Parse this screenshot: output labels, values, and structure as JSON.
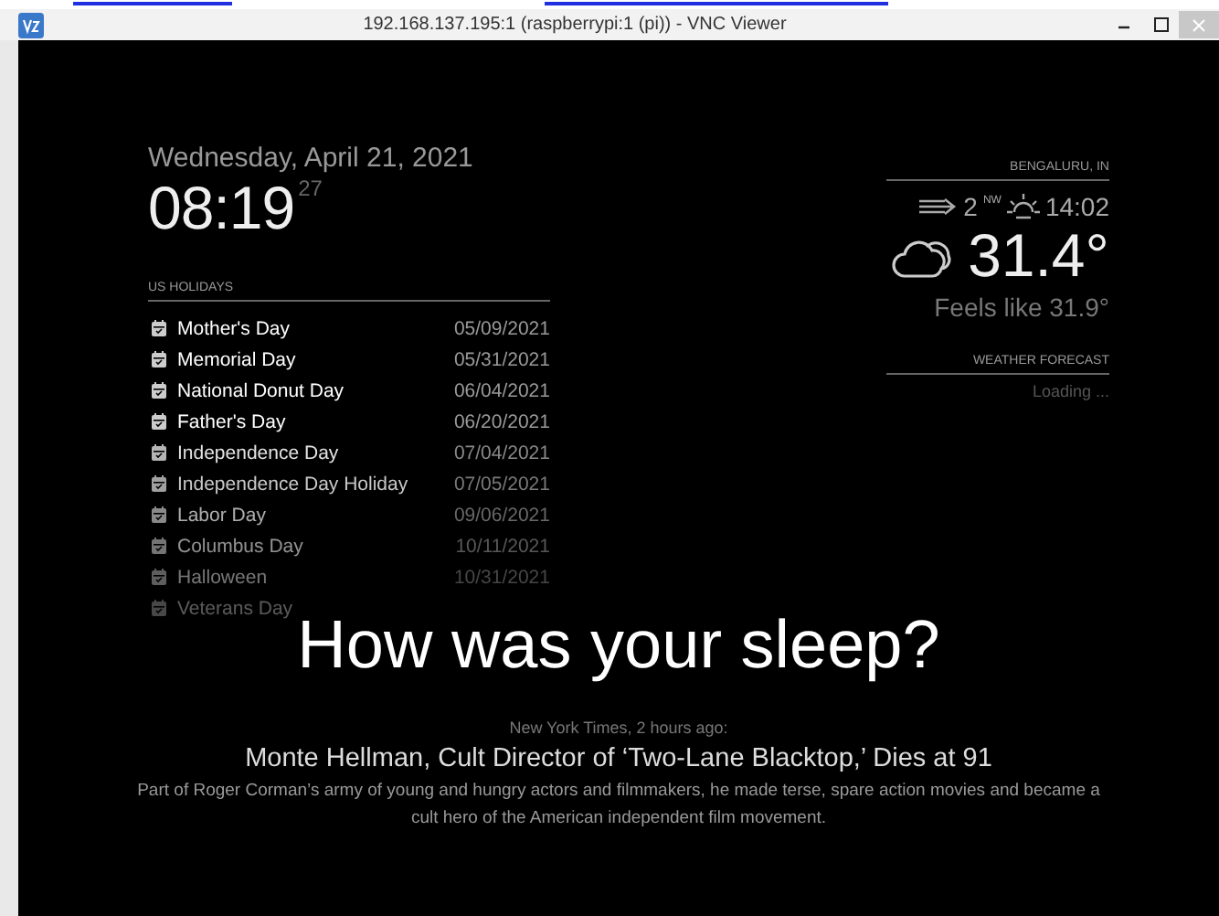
{
  "window": {
    "title": "192.168.137.195:1 (raspberrypi:1 (pi)) - VNC Viewer"
  },
  "clock": {
    "date": "Wednesday, April 21, 2021",
    "time": "08:19",
    "seconds": "27"
  },
  "holidays": {
    "header": "US HOLIDAYS",
    "items": [
      {
        "name": "Mother's Day",
        "date": "05/09/2021"
      },
      {
        "name": "Memorial Day",
        "date": "05/31/2021"
      },
      {
        "name": "National Donut Day",
        "date": "06/04/2021"
      },
      {
        "name": "Father's Day",
        "date": "06/20/2021"
      },
      {
        "name": "Independence Day",
        "date": "07/04/2021"
      },
      {
        "name": "Independence Day Holiday",
        "date": "07/05/2021"
      },
      {
        "name": "Labor Day",
        "date": "09/06/2021"
      },
      {
        "name": "Columbus Day",
        "date": "10/11/2021"
      },
      {
        "name": "Halloween",
        "date": "10/31/2021"
      },
      {
        "name": "Veterans Day"
      }
    ]
  },
  "weather": {
    "location": "BENGALURU, IN",
    "wind_speed": "2",
    "wind_direction": "NW",
    "sun_time": "14:02",
    "temperature": "31.4°",
    "feels_like": "Feels like 31.9°",
    "forecast_header": "WEATHER FORECAST",
    "forecast_status": "Loading ..."
  },
  "compliment": "How was your sleep?",
  "news": {
    "source": "New York Times, 2 hours ago:",
    "headline": "Monte Hellman, Cult Director of ‘Two-Lane Blacktop,’ Dies at 91",
    "description": "Part of Roger Corman’s army of young and hungry actors and filmmakers, he made terse, spare action movies and became a cult hero of the American independent film movement."
  }
}
